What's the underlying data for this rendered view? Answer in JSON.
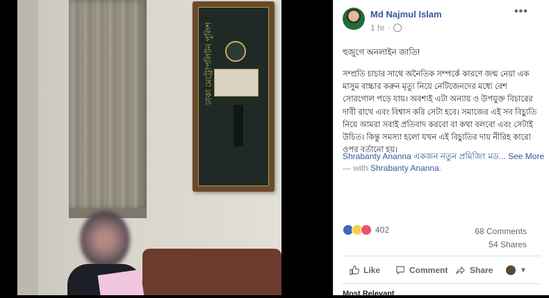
{
  "photo": {
    "plaque_text": "ঢাকা মেট্রোপলিটন পুলিশ"
  },
  "post": {
    "author": "Md Najmul Islam",
    "time": "1 hr",
    "more_label": "•••",
    "greeting": "হুজুগে অনলাইন জাতি!",
    "body": "সম্প্রতি চাচার সাথে অনৈতিক সম্পর্কে কারণে জন্ম নেয়া এক মাসুম বাচ্চার করুন মৃত্যু নিয়ে নেটিজেনদের মধ্যে বেশ সোরগোল পড়ে যায়। অবশ্যই এটা অন্যায় ও উপযুক্ত বিচারের দাবী রাখে এবং বিশ্বাস করি সেটা হবে। সমাজের এই সব বিচ্যুতি নিয়ে আমরা সবাই প্রতিবাদ করবো বা কথা বলবো এবং সেটাই উচিত। কিন্তু সমস্যা হলো যখন এই বিচ্যুতির দায় নীরিহ কারো ওপর বর্তানো হয়।",
    "line2_text": "Shrabanty Ananna একজন নতুন প্রমিজিং মড",
    "line2_dots": "...",
    "see_more": "See More",
    "with_prefix": "— with",
    "with_name": "Shrabanty Ananna",
    "with_suffix": "."
  },
  "stats": {
    "reaction_count": "402",
    "comments": "68 Comments",
    "shares": "54 Shares"
  },
  "actions": {
    "like": "Like",
    "comment": "Comment",
    "share": "Share"
  },
  "footer": {
    "cutoff_text": "Most Relevant"
  },
  "colors": {
    "link": "#365899",
    "muted": "#90949c",
    "like_reaction": "#4267b2",
    "sad_reaction": "#f7d046",
    "love_reaction": "#f0506e"
  }
}
